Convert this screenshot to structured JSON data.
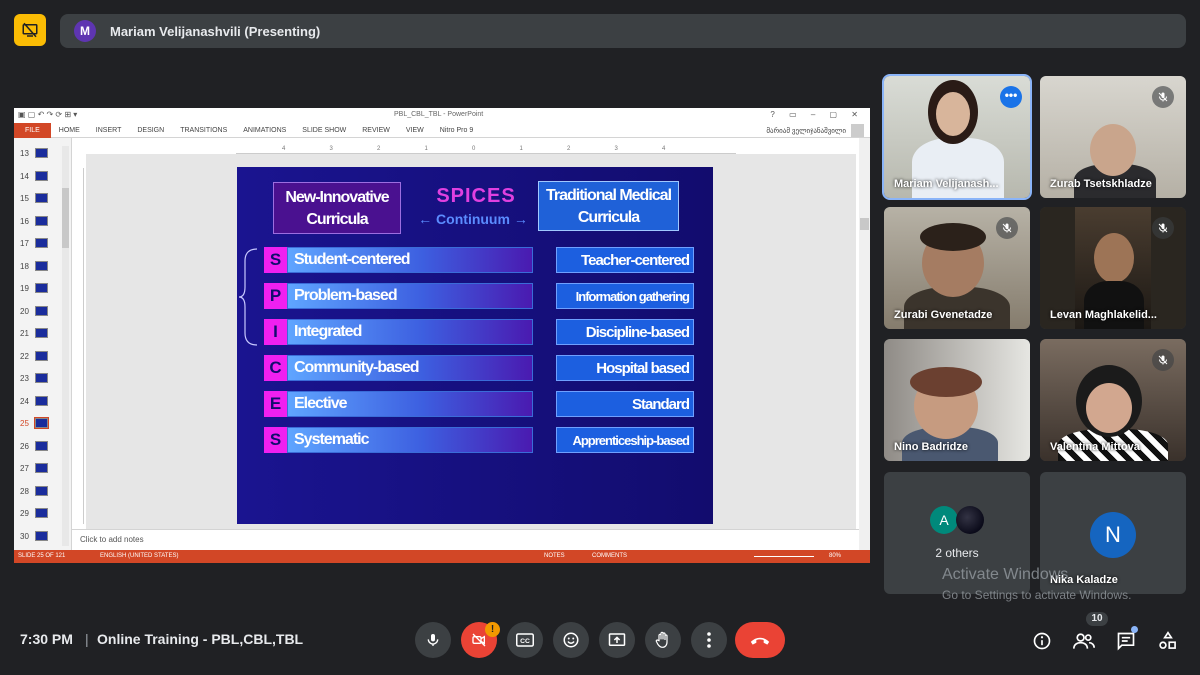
{
  "presenter": {
    "avatar_letter": "M",
    "name": "Mariam Velijanashvili (Presenting)"
  },
  "powerpoint": {
    "file_title": "PBL_CBL_TBL - PowerPoint",
    "ribbon_tabs": [
      "FILE",
      "HOME",
      "INSERT",
      "DESIGN",
      "TRANSITIONS",
      "ANIMATIONS",
      "SLIDE SHOW",
      "REVIEW",
      "VIEW",
      "Nitro Pro 9"
    ],
    "user_name": "მარიამ ველიჯანაშვილი",
    "thumbnails": [
      "13",
      "14",
      "15",
      "16",
      "17",
      "18",
      "19",
      "20",
      "21",
      "22",
      "23",
      "24",
      "25",
      "26",
      "27",
      "28",
      "29",
      "30"
    ],
    "selected_thumbnail": "25",
    "ruler_marks": [
      "4",
      "3",
      "2",
      "1",
      "0",
      "1",
      "2",
      "3",
      "4"
    ],
    "notes_placeholder": "Click to add notes",
    "status": {
      "slide": "SLIDE 25 OF 121",
      "language": "ENGLISH (UNITED STATES)",
      "notes": "NOTES",
      "comments": "COMMENTS",
      "zoom": "80%"
    }
  },
  "slide": {
    "left_header": "New-Innovative Curricula",
    "right_header": "Traditional Medical Curricula",
    "title": "SPICES",
    "subtitle": "← Continuum →",
    "rows": [
      {
        "letter": "S",
        "left": "Student-centered",
        "right": "Teacher-centered",
        "small": false
      },
      {
        "letter": "P",
        "left": "Problem-based",
        "right": "Information gathering",
        "small": true
      },
      {
        "letter": "I",
        "left": "Integrated",
        "right": "Discipline-based",
        "small": false
      },
      {
        "letter": "C",
        "left": "Community-based",
        "right": "Hospital based",
        "small": false
      },
      {
        "letter": "E",
        "left": "Elective",
        "right": "Standard",
        "small": false
      },
      {
        "letter": "S",
        "left": "Systematic",
        "right": "Apprenticeship-based",
        "small": true
      }
    ]
  },
  "participants": [
    {
      "name": "Mariam Velijanash...",
      "muted": false
    },
    {
      "name": "Zurab Tsetskhladze",
      "muted": true
    },
    {
      "name": "Zurabi Gvenetadze",
      "muted": true
    },
    {
      "name": "Levan Maghlakelid...",
      "muted": true
    },
    {
      "name": "Nino Badridze",
      "muted": false
    },
    {
      "name": "Valentina Mittova",
      "muted": true
    },
    {
      "name": "2 others",
      "avatar_letter": "A"
    },
    {
      "name": "Nika Kaladze",
      "avatar_letter": "N"
    }
  ],
  "watermark": {
    "line1": "Activate Windows",
    "line2": "Go to Settings to activate Windows."
  },
  "bottom": {
    "time": "7:30 PM",
    "separator": "|",
    "meeting": "Online Training - PBL,CBL,TBL",
    "camera_alert": "!",
    "captions_label": "CC",
    "people_count": "10"
  },
  "colors": {
    "accent": "#8ab4f8",
    "end_call": "#ea4335",
    "present_icon": "#fbbc04",
    "ppt_red": "#d24726"
  }
}
